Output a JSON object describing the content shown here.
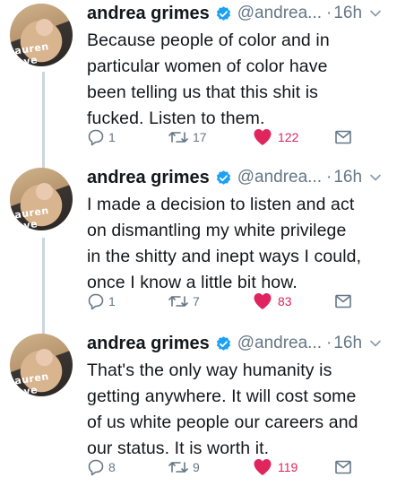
{
  "tweets": [
    {
      "author_name": "andrea grimes",
      "handle": "@andrea...",
      "separator": "·",
      "time": "16h",
      "text": "Because people of color and in\nparticular women of color have\nbeen telling us that this shit is\nfucked. Listen to them.",
      "replies": "1",
      "retweets": "17",
      "likes": "122"
    },
    {
      "author_name": "andrea grimes",
      "handle": "@andrea...",
      "separator": "·",
      "time": "16h",
      "text": "I made a decision to listen and act\non dismantling my white privilege\nin the shitty and inept ways I could,\nonce I know a little bit how.",
      "replies": "1",
      "retweets": "7",
      "likes": "83"
    },
    {
      "author_name": "andrea grimes",
      "handle": "@andrea...",
      "separator": "·",
      "time": "16h",
      "text": "That's the only way humanity is\ngetting anywhere. It will cost some\nof us white people our careers and\nour status. It is worth it.",
      "replies": "8",
      "retweets": "9",
      "likes": "119"
    }
  ],
  "avatar_shirt_text": "auren\nuve",
  "colors": {
    "verified_blue": "#1da1f2",
    "like_red": "#e0245e",
    "meta_gray": "#657786",
    "thread_gray": "#ccd6dd"
  },
  "icons": [
    "verified-badge-icon",
    "chevron-down-icon",
    "reply-icon",
    "retweet-icon",
    "heart-icon",
    "direct-message-icon"
  ]
}
